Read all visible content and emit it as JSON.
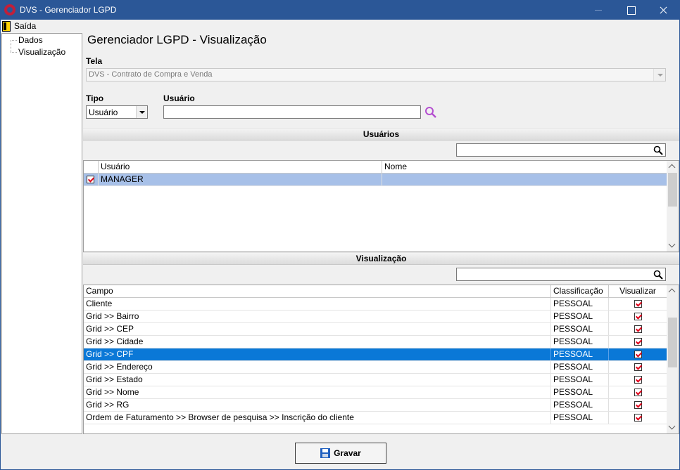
{
  "window": {
    "title": "DVS - Gerenciador LGPD"
  },
  "menu": {
    "exit_label": "Saída"
  },
  "tree": {
    "items": [
      "Dados",
      "Visualização"
    ]
  },
  "page": {
    "title": "Gerenciador LGPD - Visualização"
  },
  "form": {
    "tela_label": "Tela",
    "tela_value": "DVS - Contrato de Compra e Venda",
    "tipo_label": "Tipo",
    "tipo_value": "Usuário",
    "usuario_label": "Usuário",
    "usuario_value": ""
  },
  "usuarios": {
    "section_title": "Usuários",
    "filter_value": "",
    "columns": [
      "Usuário",
      "Nome"
    ],
    "rows": [
      {
        "checked": true,
        "usuario": "MANAGER",
        "nome": ""
      }
    ]
  },
  "visualizacao": {
    "section_title": "Visualização",
    "filter_value": "",
    "columns": [
      "Campo",
      "Classificação",
      "Visualizar"
    ],
    "rows": [
      {
        "campo": "Cliente",
        "classificacao": "PESSOAL",
        "visualizar": true
      },
      {
        "campo": "Grid >> Bairro",
        "classificacao": "PESSOAL",
        "visualizar": true
      },
      {
        "campo": "Grid >> CEP",
        "classificacao": "PESSOAL",
        "visualizar": true
      },
      {
        "campo": "Grid >> Cidade",
        "classificacao": "PESSOAL",
        "visualizar": true
      },
      {
        "campo": "Grid >> CPF",
        "classificacao": "PESSOAL",
        "visualizar": true
      },
      {
        "campo": "Grid >> Endereço",
        "classificacao": "PESSOAL",
        "visualizar": true
      },
      {
        "campo": "Grid >> Estado",
        "classificacao": "PESSOAL",
        "visualizar": true
      },
      {
        "campo": "Grid >> Nome",
        "classificacao": "PESSOAL",
        "visualizar": true
      },
      {
        "campo": "Grid >> RG",
        "classificacao": "PESSOAL",
        "visualizar": true
      },
      {
        "campo": "Ordem de Faturamento >> Browser de pesquisa >> Inscrição do cliente",
        "classificacao": "PESSOAL",
        "visualizar": true
      }
    ]
  },
  "actions": {
    "save_label": "Gravar"
  },
  "colors": {
    "titlebar": "#2b5797",
    "selection": "#0a78d7",
    "selection_light": "#a7c0e8",
    "check": "#e0001a",
    "lookup_icon": "#b44fd0"
  }
}
